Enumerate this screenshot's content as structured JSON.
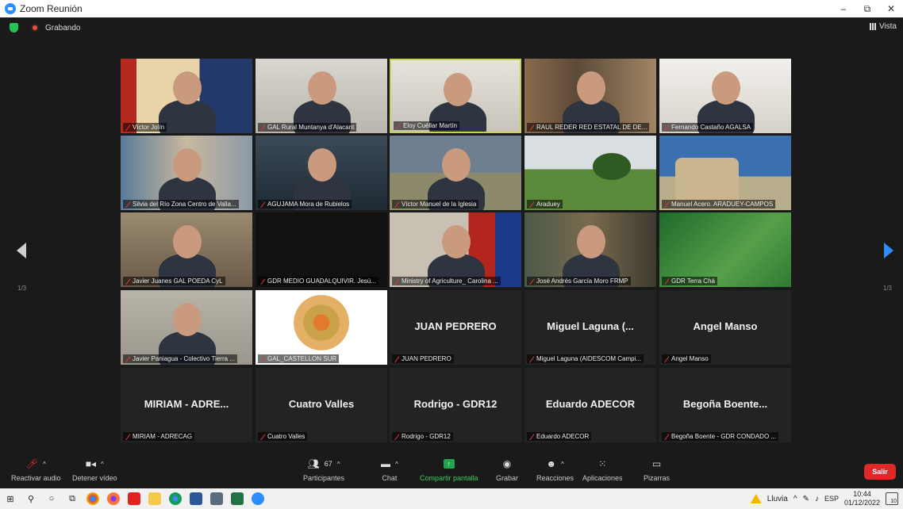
{
  "window": {
    "title": "Zoom Reunión",
    "controls": [
      "–",
      "⧉",
      "✕"
    ]
  },
  "top": {
    "recording_label": "Grabando",
    "view_label": "Vista"
  },
  "pagination": {
    "left": "1/3",
    "right": "1/3"
  },
  "tiles": [
    {
      "name": "Víctor Jolín",
      "big": ""
    },
    {
      "name": "GAL Rural Muntanya d'Alacant",
      "big": ""
    },
    {
      "name": "Eloy Cuéllar Martín",
      "big": ""
    },
    {
      "name": "RAUL REDER RED ESTATAL DE DE...",
      "big": ""
    },
    {
      "name": "Fernando Castaño AGALSA",
      "big": ""
    },
    {
      "name": "Silvia del Río Zona Centro de Valla...",
      "big": ""
    },
    {
      "name": "AGUJAMA Mora de Rubielos",
      "big": ""
    },
    {
      "name": "Víctor Manuel de la Iglesia",
      "big": ""
    },
    {
      "name": "Araduey",
      "big": ""
    },
    {
      "name": "Manuel Acero. ARADUEY-CAMPOS",
      "big": ""
    },
    {
      "name": "Javier Juanes GAL POEDA CyL",
      "big": ""
    },
    {
      "name": "GDR MEDIO GUADALQUIVIR. Jesú...",
      "big": ""
    },
    {
      "name": "Ministry of Agriculture_ Carolina ...",
      "big": ""
    },
    {
      "name": "José Andrés García Moro FRMP",
      "big": ""
    },
    {
      "name": "GDR Terra Chá",
      "big": ""
    },
    {
      "name": "Javier Paniagua - Colectivo Tierra ...",
      "big": ""
    },
    {
      "name": "GAL_CASTELLON SUR",
      "big": ""
    },
    {
      "name": "JUAN PEDRERO",
      "big": "JUAN PEDRERO"
    },
    {
      "name": "Miguel Laguna (AIDESCOM Campi...",
      "big": "Miguel Laguna (..."
    },
    {
      "name": "Angel Manso",
      "big": "Angel Manso"
    },
    {
      "name": "MIRIAM - ADRECAG",
      "big": "MIRIAM - ADRE..."
    },
    {
      "name": "Cuatro Valles",
      "big": "Cuatro Valles"
    },
    {
      "name": "Rodrigo - GDR12",
      "big": "Rodrigo - GDR12"
    },
    {
      "name": "Eduardo ADECOR",
      "big": "Eduardo ADECOR"
    },
    {
      "name": "Begoña Boente - GDR CONDADO ...",
      "big": "Begoña Boente..."
    }
  ],
  "toolbar": {
    "audio": "Reactivar audio",
    "video": "Detener vídeo",
    "participants": "Participantes",
    "participants_count": "67",
    "chat": "Chat",
    "share": "Compartir pantalla",
    "record": "Grabar",
    "reactions": "Reacciones",
    "apps": "Aplicaciones",
    "whiteboards": "Pizarras",
    "leave": "Salir"
  },
  "taskbar": {
    "weather": "Lluvia",
    "lang": "ESP",
    "time": "10:44",
    "date": "01/12/2022",
    "notifications": "10"
  },
  "colors": {
    "accent": "#2d8cff",
    "active_speaker": "#c9d34a",
    "leave": "#e02828",
    "share": "#23a54a"
  }
}
